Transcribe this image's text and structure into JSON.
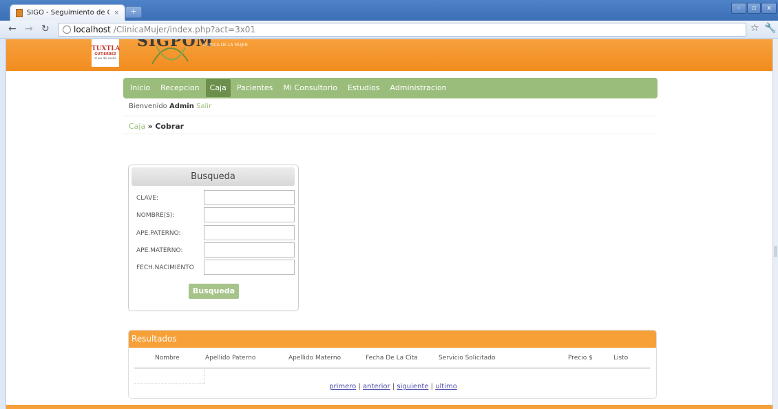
{
  "browser": {
    "tab_title": "SIGO - Seguimiento de Ofic",
    "tab_close": "×",
    "new_tab": "+",
    "win_min": "–",
    "win_max": "▫",
    "win_close": "x",
    "url_host": "localhost",
    "url_path": "/ClinicaMujer/index.php?act=3x01"
  },
  "banner": {
    "logo_line1": "TUXTLA",
    "logo_line2": "GUTIERREZ",
    "logo_line3": "al pie del sueño",
    "brand": "SIGPOM",
    "subtitle": "CLINICA DE LA MUJER"
  },
  "menu": {
    "items": [
      "Inicio",
      "Recepcion",
      "Caja",
      "Pacientes",
      "Mi Consultorio",
      "Estudios",
      "Administracion"
    ],
    "active": "Caja"
  },
  "welcome": {
    "prefix": "Bienvenido",
    "user": "Admin",
    "logout": "Salir"
  },
  "breadcrumb": {
    "parent": "Caja",
    "sep": "»",
    "current": "Cobrar"
  },
  "search": {
    "title": "Busqueda",
    "fields": [
      "CLAVE:",
      "NOMBRE(S):",
      "APE.PATERNO:",
      "APE.MATERNO:",
      "FECH.NACIMIENTO"
    ],
    "button": "Busqueda"
  },
  "results": {
    "title": "Resultados",
    "columns": [
      "Nombre",
      "Apellido Paterno",
      "Apellido Materno",
      "Fecha De La Cita",
      "Servicio Solicitado",
      "Precio $",
      "Listo"
    ],
    "pager": {
      "first": "primero",
      "prev": "anterior",
      "next": "siguiente",
      "last": "ultimo",
      "sep": "|"
    }
  }
}
